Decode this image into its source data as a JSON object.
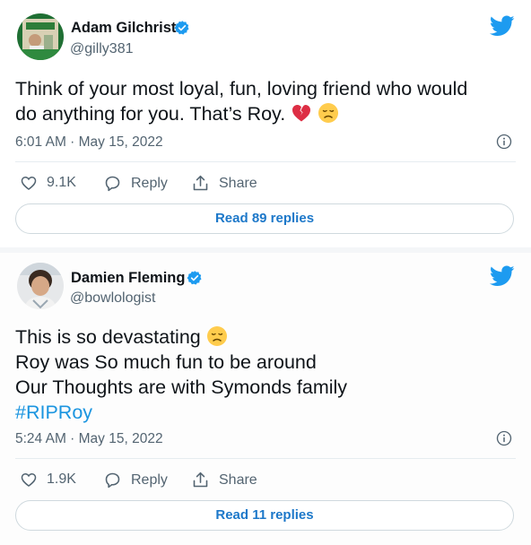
{
  "colors": {
    "link": "#1b95e0",
    "twitter_blue": "#1d9bf0",
    "muted": "#536471",
    "like_heart": "#e0245e"
  },
  "tweets": [
    {
      "author_name": "Adam Gilchrist",
      "handle": "@gilly381",
      "text_lines": [
        "Think of your most loyal, fun, loving friend who would",
        "do anything for you. That’s Roy."
      ],
      "emojis": [
        "broken-heart-icon",
        "disappointed-face-icon"
      ],
      "timestamp": "6:01 AM · May 15, 2022",
      "likes": "9.1K",
      "reply_label": "Reply",
      "share_label": "Share",
      "read_replies_label": "Read 89 replies"
    },
    {
      "author_name": "Damien Fleming",
      "handle": "@bowlologist",
      "text_lines": [
        "This is so devastating",
        "Roy was So much fun to be around",
        "Our Thoughts are with Symonds family"
      ],
      "hashtag": "#RIPRoy",
      "emojis": [
        "disappointed-face-icon"
      ],
      "timestamp": "5:24 AM · May 15, 2022",
      "likes": "1.9K",
      "reply_label": "Reply",
      "share_label": "Share",
      "read_replies_label": "Read 11 replies"
    }
  ]
}
